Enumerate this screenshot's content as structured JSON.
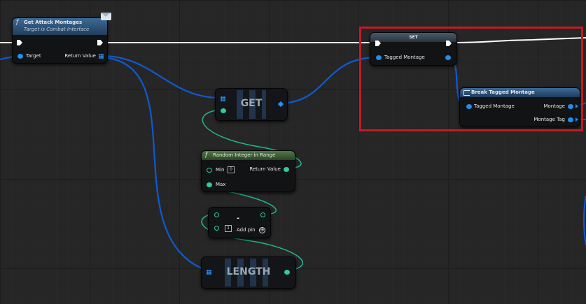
{
  "nodes": {
    "get_attack_montages": {
      "title": "Get Attack Montages",
      "subtitle": "Target is Combat Interface",
      "function_glyph": "f",
      "pin_target": "Target",
      "pin_return": "Return Value"
    },
    "set": {
      "title": "SET",
      "pin_tagged_montage": "Tagged Montage"
    },
    "break_tagged_montage": {
      "title": "Break Tagged Montage",
      "pin_in": "Tagged Montage",
      "pin_montage": "Montage",
      "pin_montage_tag": "Montage Tag"
    },
    "get": {
      "label": "GET"
    },
    "random_integer": {
      "title": "Random Integer in Range",
      "function_glyph": "f",
      "pin_min": "Min",
      "min_value": "0",
      "pin_max": "Max",
      "pin_return": "Return Value"
    },
    "subtract": {
      "label": "-",
      "value": "1",
      "add_pin": "Add pin",
      "add_pin_icon": "⊕"
    },
    "length": {
      "label": "LENGTH"
    }
  },
  "colors": {
    "background": "#262626",
    "grid_line": "#1d1d1d",
    "exec_wire": "#ffffff",
    "object_wire": "#0d5bd1",
    "integer_wire": "#1fb890",
    "highlight": "#c51a21",
    "function_header": "#2a4f77",
    "pure_header": "#3c5a34"
  }
}
